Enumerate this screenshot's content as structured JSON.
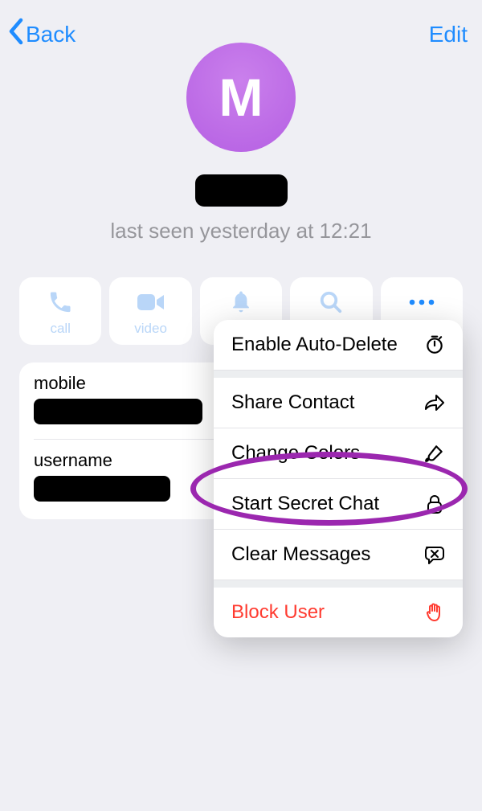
{
  "header": {
    "back_label": "Back",
    "edit_label": "Edit"
  },
  "avatar": {
    "initial": "M"
  },
  "status_text": "last seen yesterday at 12:21",
  "actions": {
    "call": "call",
    "video": "video",
    "mute": "mute",
    "search": "search",
    "more": "more"
  },
  "info": {
    "mobile_label": "mobile",
    "username_label": "username"
  },
  "menu": {
    "auto_delete": "Enable Auto-Delete",
    "share_contact": "Share Contact",
    "change_colors": "Change Colors",
    "start_secret": "Start Secret Chat",
    "clear_messages": "Clear Messages",
    "block_user": "Block User"
  },
  "colors": {
    "accent": "#1f8cff",
    "muted_icon": "#b9d6f8",
    "danger": "#ff3b30",
    "highlight": "#9b27af"
  }
}
